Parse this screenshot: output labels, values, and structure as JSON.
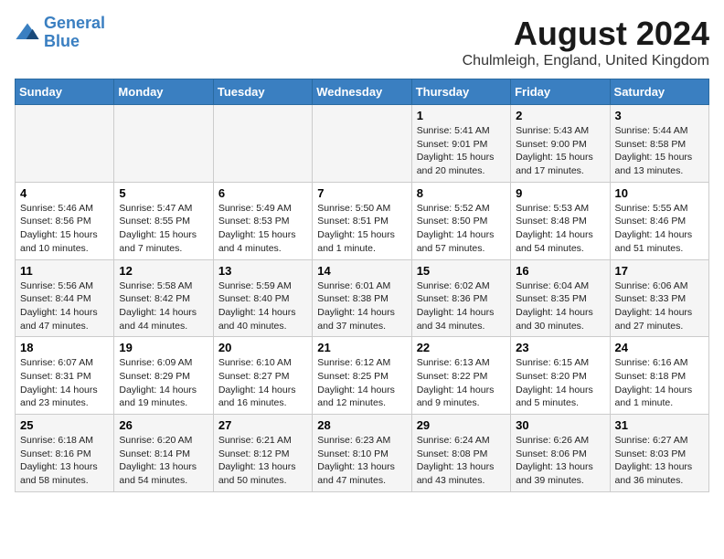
{
  "logo": {
    "line1": "General",
    "line2": "Blue"
  },
  "title": "August 2024",
  "subtitle": "Chulmleigh, England, United Kingdom",
  "days_of_week": [
    "Sunday",
    "Monday",
    "Tuesday",
    "Wednesday",
    "Thursday",
    "Friday",
    "Saturday"
  ],
  "weeks": [
    [
      {
        "day": "",
        "info": ""
      },
      {
        "day": "",
        "info": ""
      },
      {
        "day": "",
        "info": ""
      },
      {
        "day": "",
        "info": ""
      },
      {
        "day": "1",
        "info": "Sunrise: 5:41 AM\nSunset: 9:01 PM\nDaylight: 15 hours\nand 20 minutes."
      },
      {
        "day": "2",
        "info": "Sunrise: 5:43 AM\nSunset: 9:00 PM\nDaylight: 15 hours\nand 17 minutes."
      },
      {
        "day": "3",
        "info": "Sunrise: 5:44 AM\nSunset: 8:58 PM\nDaylight: 15 hours\nand 13 minutes."
      }
    ],
    [
      {
        "day": "4",
        "info": "Sunrise: 5:46 AM\nSunset: 8:56 PM\nDaylight: 15 hours\nand 10 minutes."
      },
      {
        "day": "5",
        "info": "Sunrise: 5:47 AM\nSunset: 8:55 PM\nDaylight: 15 hours\nand 7 minutes."
      },
      {
        "day": "6",
        "info": "Sunrise: 5:49 AM\nSunset: 8:53 PM\nDaylight: 15 hours\nand 4 minutes."
      },
      {
        "day": "7",
        "info": "Sunrise: 5:50 AM\nSunset: 8:51 PM\nDaylight: 15 hours\nand 1 minute."
      },
      {
        "day": "8",
        "info": "Sunrise: 5:52 AM\nSunset: 8:50 PM\nDaylight: 14 hours\nand 57 minutes."
      },
      {
        "day": "9",
        "info": "Sunrise: 5:53 AM\nSunset: 8:48 PM\nDaylight: 14 hours\nand 54 minutes."
      },
      {
        "day": "10",
        "info": "Sunrise: 5:55 AM\nSunset: 8:46 PM\nDaylight: 14 hours\nand 51 minutes."
      }
    ],
    [
      {
        "day": "11",
        "info": "Sunrise: 5:56 AM\nSunset: 8:44 PM\nDaylight: 14 hours\nand 47 minutes."
      },
      {
        "day": "12",
        "info": "Sunrise: 5:58 AM\nSunset: 8:42 PM\nDaylight: 14 hours\nand 44 minutes."
      },
      {
        "day": "13",
        "info": "Sunrise: 5:59 AM\nSunset: 8:40 PM\nDaylight: 14 hours\nand 40 minutes."
      },
      {
        "day": "14",
        "info": "Sunrise: 6:01 AM\nSunset: 8:38 PM\nDaylight: 14 hours\nand 37 minutes."
      },
      {
        "day": "15",
        "info": "Sunrise: 6:02 AM\nSunset: 8:36 PM\nDaylight: 14 hours\nand 34 minutes."
      },
      {
        "day": "16",
        "info": "Sunrise: 6:04 AM\nSunset: 8:35 PM\nDaylight: 14 hours\nand 30 minutes."
      },
      {
        "day": "17",
        "info": "Sunrise: 6:06 AM\nSunset: 8:33 PM\nDaylight: 14 hours\nand 27 minutes."
      }
    ],
    [
      {
        "day": "18",
        "info": "Sunrise: 6:07 AM\nSunset: 8:31 PM\nDaylight: 14 hours\nand 23 minutes."
      },
      {
        "day": "19",
        "info": "Sunrise: 6:09 AM\nSunset: 8:29 PM\nDaylight: 14 hours\nand 19 minutes."
      },
      {
        "day": "20",
        "info": "Sunrise: 6:10 AM\nSunset: 8:27 PM\nDaylight: 14 hours\nand 16 minutes."
      },
      {
        "day": "21",
        "info": "Sunrise: 6:12 AM\nSunset: 8:25 PM\nDaylight: 14 hours\nand 12 minutes."
      },
      {
        "day": "22",
        "info": "Sunrise: 6:13 AM\nSunset: 8:22 PM\nDaylight: 14 hours\nand 9 minutes."
      },
      {
        "day": "23",
        "info": "Sunrise: 6:15 AM\nSunset: 8:20 PM\nDaylight: 14 hours\nand 5 minutes."
      },
      {
        "day": "24",
        "info": "Sunrise: 6:16 AM\nSunset: 8:18 PM\nDaylight: 14 hours\nand 1 minute."
      }
    ],
    [
      {
        "day": "25",
        "info": "Sunrise: 6:18 AM\nSunset: 8:16 PM\nDaylight: 13 hours\nand 58 minutes."
      },
      {
        "day": "26",
        "info": "Sunrise: 6:20 AM\nSunset: 8:14 PM\nDaylight: 13 hours\nand 54 minutes."
      },
      {
        "day": "27",
        "info": "Sunrise: 6:21 AM\nSunset: 8:12 PM\nDaylight: 13 hours\nand 50 minutes."
      },
      {
        "day": "28",
        "info": "Sunrise: 6:23 AM\nSunset: 8:10 PM\nDaylight: 13 hours\nand 47 minutes."
      },
      {
        "day": "29",
        "info": "Sunrise: 6:24 AM\nSunset: 8:08 PM\nDaylight: 13 hours\nand 43 minutes."
      },
      {
        "day": "30",
        "info": "Sunrise: 6:26 AM\nSunset: 8:06 PM\nDaylight: 13 hours\nand 39 minutes."
      },
      {
        "day": "31",
        "info": "Sunrise: 6:27 AM\nSunset: 8:03 PM\nDaylight: 13 hours\nand 36 minutes."
      }
    ]
  ]
}
